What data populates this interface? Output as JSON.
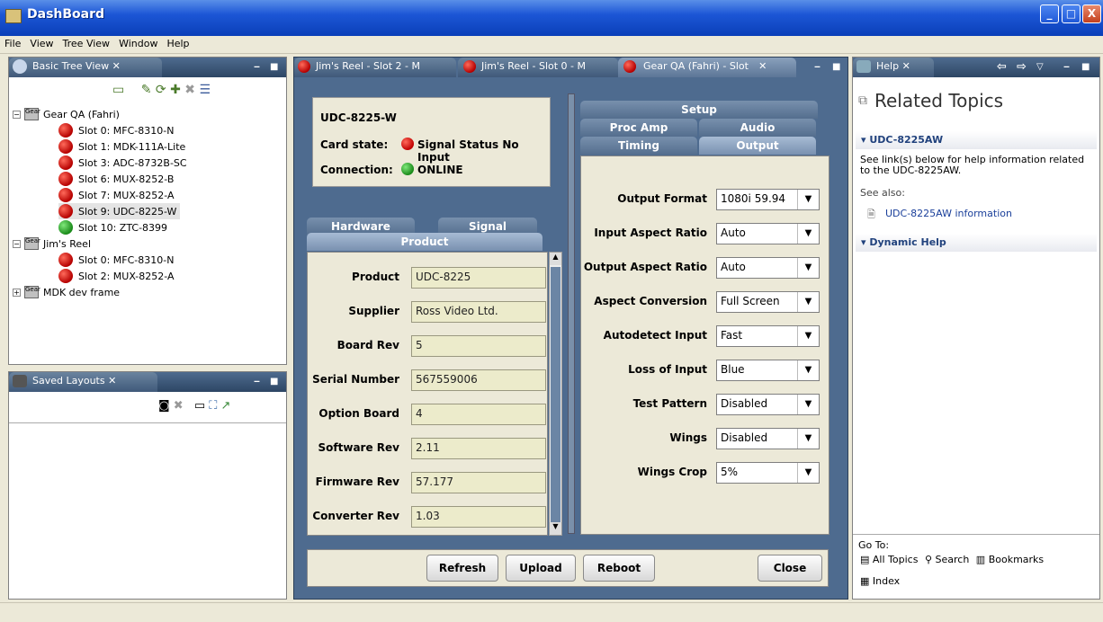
{
  "window": {
    "title": "DashBoard",
    "min": "_",
    "max": "□",
    "close": "X"
  },
  "menu": [
    "File",
    "View",
    "Tree View",
    "Window",
    "Help"
  ],
  "tree_view": {
    "tab_label": "Basic Tree View",
    "nodes": [
      {
        "label": "Gear QA (Fahri)",
        "kind": "frame"
      },
      {
        "label": "Slot 0: MFC-8310-N",
        "status": "red"
      },
      {
        "label": "Slot 1: MDK-111A-Lite",
        "status": "red"
      },
      {
        "label": "Slot 3: ADC-8732B-SC",
        "status": "red"
      },
      {
        "label": "Slot 6: MUX-8252-B",
        "status": "red"
      },
      {
        "label": "Slot 7: MUX-8252-A",
        "status": "red"
      },
      {
        "label": "Slot 9: UDC-8225-W",
        "status": "red"
      },
      {
        "label": "Slot 10: ZTC-8399",
        "status": "green"
      },
      {
        "label": "Jim's Reel",
        "kind": "frame"
      },
      {
        "label": "Slot 0: MFC-8310-N",
        "status": "red"
      },
      {
        "label": "Slot 2: MUX-8252-A",
        "status": "red"
      },
      {
        "label": "MDK dev frame",
        "kind": "frame"
      }
    ]
  },
  "saved_layouts": {
    "tab_label": "Saved Layouts"
  },
  "editor_tabs": [
    "Jim's Reel - Slot 2 - M",
    "Jim's Reel - Slot 0 - M",
    "Gear QA (Fahri) - Slot"
  ],
  "card": {
    "name": "UDC-8225-W",
    "state_label": "Card state:",
    "state_value": "Signal Status No Input",
    "connection_label": "Connection:",
    "connection_value": "ONLINE"
  },
  "left_tabs": {
    "hardware": "Hardware",
    "signal": "Signal",
    "product": "Product"
  },
  "product_fields": [
    {
      "label": "Product",
      "value": "UDC-8225"
    },
    {
      "label": "Supplier",
      "value": "Ross Video Ltd."
    },
    {
      "label": "Board Rev",
      "value": "5"
    },
    {
      "label": "Serial Number",
      "value": "567559006"
    },
    {
      "label": "Option Board",
      "value": "4"
    },
    {
      "label": "Software Rev",
      "value": "2.11"
    },
    {
      "label": "Firmware Rev",
      "value": "57.177"
    },
    {
      "label": "Converter Rev",
      "value": "1.03"
    }
  ],
  "right_tabs": {
    "setup": "Setup",
    "proc_amp": "Proc Amp",
    "audio": "Audio",
    "timing": "Timing",
    "output": "Output"
  },
  "output_fields": [
    {
      "label": "Output Format",
      "value": "1080i 59.94"
    },
    {
      "label": "Input Aspect Ratio",
      "value": "Auto"
    },
    {
      "label": "Output Aspect Ratio",
      "value": "Auto"
    },
    {
      "label": "Aspect Conversion",
      "value": "Full Screen"
    },
    {
      "label": "Autodetect Input",
      "value": "Fast"
    },
    {
      "label": "Loss of Input",
      "value": "Blue"
    },
    {
      "label": "Test Pattern",
      "value": "Disabled"
    },
    {
      "label": "Wings",
      "value": "Disabled"
    },
    {
      "label": "Wings Crop",
      "value": "5%"
    }
  ],
  "buttons": {
    "refresh": "Refresh",
    "upload": "Upload",
    "reboot": "Reboot",
    "close": "Close"
  },
  "help": {
    "tab_label": "Help",
    "title": "Related Topics",
    "section1": "UDC-8225AW",
    "desc": "See link(s) below for help information related to the UDC-8225AW.",
    "see_also": "See also:",
    "link": "UDC-8225AW information",
    "section2": "Dynamic Help",
    "goto": "Go To:",
    "all_topics": "All Topics",
    "search": "Search",
    "bookmarks": "Bookmarks",
    "index": "Index"
  }
}
